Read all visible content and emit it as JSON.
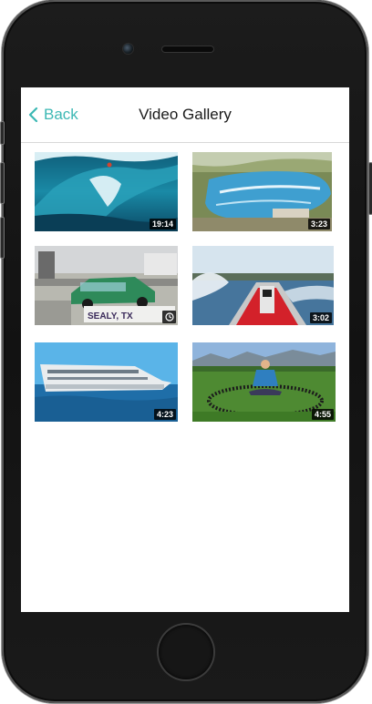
{
  "navbar": {
    "back_label": "Back",
    "title": "Video Gallery"
  },
  "videos": [
    {
      "subject": "surfer on a large wave",
      "duration": "19:14"
    },
    {
      "subject": "aerial view of wave pool",
      "duration": "3:23"
    },
    {
      "subject": "green car at drag strip",
      "badge": "clock-icon"
    },
    {
      "subject": "speedboat racing on lake",
      "duration": "3:02"
    },
    {
      "subject": "white superyacht at sea",
      "duration": "4:23"
    },
    {
      "subject": "man sitting inside a ring of dominoes on grass",
      "duration": "4:55"
    }
  ],
  "thumb_overlay_texts": {
    "drag_sign": "SEALY, TX"
  },
  "colors": {
    "accent": "#3cb8b4",
    "title": "#1a1a1a",
    "divider": "#d8d8d8"
  }
}
